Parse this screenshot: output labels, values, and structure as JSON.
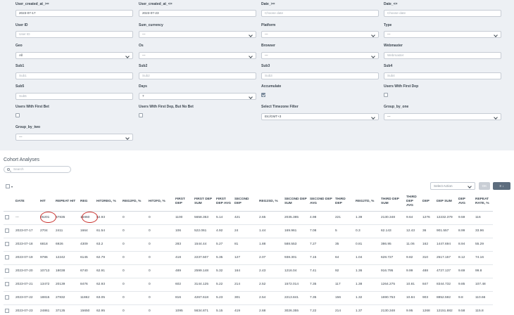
{
  "filters": {
    "user_created_at_from": {
      "label": "User_created_at_>=",
      "value": "2023-07-17"
    },
    "user_created_at_to": {
      "label": "User_created_at_<=",
      "value": "2023-07-23"
    },
    "date_from": {
      "label": "Date_>=",
      "placeholder": "Choose date"
    },
    "date_to": {
      "label": "Date_<=",
      "placeholder": "Choose date"
    },
    "user_id": {
      "label": "User ID",
      "placeholder": "User ID"
    },
    "sum_currency": {
      "label": "Sum_currency",
      "value": "---"
    },
    "platform": {
      "label": "Platform",
      "value": "---"
    },
    "type": {
      "label": "Type",
      "value": "---"
    },
    "geo": {
      "label": "Geo",
      "value": "All"
    },
    "os": {
      "label": "Os",
      "value": "---"
    },
    "browser": {
      "label": "Browser",
      "value": "---"
    },
    "webmaster": {
      "label": "Webmaster",
      "placeholder": "Webmaster"
    },
    "sub1": {
      "label": "Sub1",
      "placeholder": "Sub1"
    },
    "sub2": {
      "label": "Sub2",
      "placeholder": "Sub2"
    },
    "sub3": {
      "label": "Sub3",
      "placeholder": "Sub3"
    },
    "sub4": {
      "label": "Sub4",
      "placeholder": "Sub4"
    },
    "sub5": {
      "label": "Sub5",
      "placeholder": "Sub5"
    },
    "days": {
      "label": "Days",
      "value": "7"
    },
    "accumulate": {
      "label": "Accumulate",
      "checked": true
    },
    "users_with_first_dep": {
      "label": "Users With First Dep",
      "checked": false
    },
    "users_with_first_bet": {
      "label": "Users With First Bet",
      "checked": false
    },
    "users_with_first_dep_not_bet": {
      "label": "Users With First Dep, But No Bet",
      "checked": false
    },
    "select_timezone": {
      "label": "Select Timezone Filter",
      "value": "Etc/GMT+3"
    },
    "group_by_one": {
      "label": "Group_by_one",
      "value": "---"
    },
    "group_by_two": {
      "label": "Group_by_two",
      "value": "---"
    }
  },
  "section": {
    "title": "Cohort Analyses",
    "search_placeholder": "Search"
  },
  "toolbar": {
    "select_action": "Select Action",
    "ok_label": "OK",
    "filter_label": "≡ ↓"
  },
  "table": {
    "columns": [
      "DATE",
      "HIT",
      "REPEAT HIT",
      "REG",
      "HIT2REG, %",
      "REG2FD, %",
      "HIT2FD, %",
      "FIRST DEP",
      "FIRST DEP SUM",
      "FIRST DEP AVG",
      "SECOND DEP",
      "REG2SD, %",
      "SECOND DEP SUM",
      "SECOND DEP AVG",
      "THIRD DEP",
      "REG2TD, %",
      "THIRD DEP SUM",
      "THIRD DEP AVG",
      "DEP",
      "DEP SUM",
      "DEP AVG",
      "REPEAT RATE, %"
    ],
    "rows": [
      [
        "---",
        "25201",
        "37835",
        "15860",
        "62.93",
        "0",
        "0",
        "1100",
        "5658.353",
        "5.14",
        "421",
        "2.65",
        "2035.385",
        "4.98",
        "221",
        "1.39",
        "2130.348",
        "9.64",
        "1276",
        "12232.379",
        "9.59",
        "116"
      ],
      [
        "2023-07-17",
        "2704",
        "2411",
        "1664",
        "61.54",
        "0",
        "0",
        "106",
        "522.061",
        "4.92",
        "24",
        "1.44",
        "169.961",
        "7.08",
        "5",
        "0.3",
        "62.143",
        "12.43",
        "36",
        "901.557",
        "8.99",
        "33.96"
      ],
      [
        "2023-07-18",
        "6818",
        "6926",
        "4309",
        "63.2",
        "0",
        "0",
        "283",
        "1544.44",
        "5.27",
        "81",
        "1.88",
        "588.553",
        "7.27",
        "35",
        "0.81",
        "386.95",
        "11.06",
        "162",
        "1447.694",
        "8.94",
        "55.29"
      ],
      [
        "2023-07-19",
        "9786",
        "12242",
        "6145",
        "62.79",
        "0",
        "0",
        "418",
        "2237.507",
        "5.35",
        "127",
        "2.07",
        "938.301",
        "7.15",
        "64",
        "1.04",
        "628.727",
        "9.82",
        "310",
        "2517.157",
        "8.12",
        "74.16"
      ],
      [
        "2023-07-20",
        "10713",
        "18038",
        "6740",
        "62.91",
        "0",
        "0",
        "489",
        "2599.148",
        "5.32",
        "164",
        "2.43",
        "1216.04",
        "7.41",
        "92",
        "1.36",
        "916.795",
        "9.99",
        "488",
        "4727.137",
        "9.69",
        "99.8"
      ],
      [
        "2023-07-21",
        "13472",
        "20139",
        "8476",
        "62.93",
        "0",
        "0",
        "602",
        "3144.125",
        "5.22",
        "214",
        "2.52",
        "1572.014",
        "7.35",
        "117",
        "1.38",
        "1264.275",
        "10.81",
        "847",
        "8344.732",
        "9.85",
        "107.48"
      ],
      [
        "2023-07-22",
        "18815",
        "27832",
        "11862",
        "63.05",
        "0",
        "0",
        "816",
        "4267.618",
        "5.23",
        "301",
        "2.54",
        "2213.841",
        "7.35",
        "156",
        "1.32",
        "1690.753",
        "10.84",
        "903",
        "8852.592",
        "9.8",
        "110.66"
      ],
      [
        "2023-07-23",
        "24861",
        "37135",
        "15650",
        "62.95",
        "0",
        "0",
        "1095",
        "5634.871",
        "5.15",
        "419",
        "2.68",
        "3026.355",
        "7.22",
        "214",
        "1.37",
        "2130.348",
        "9.95",
        "1268",
        "12151.882",
        "9.58",
        "115.8"
      ]
    ]
  }
}
